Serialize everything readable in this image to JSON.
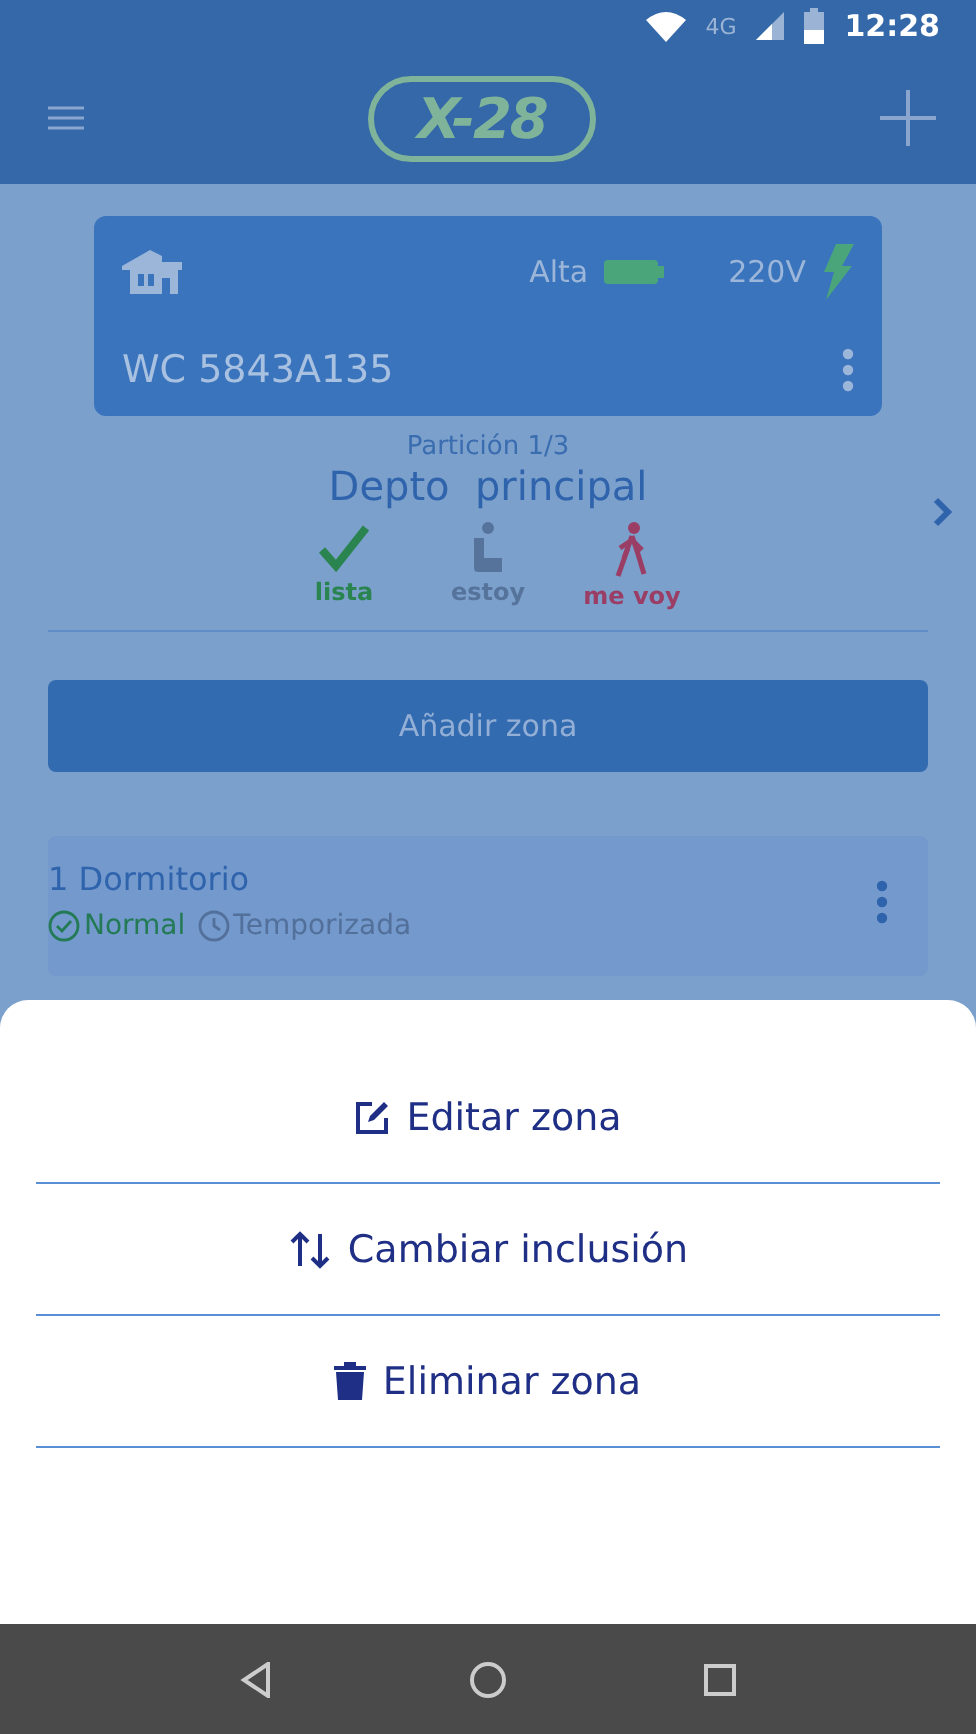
{
  "status_bar": {
    "network": "4G",
    "time": "12:28"
  },
  "app_bar": {
    "logo": "X-28"
  },
  "panel": {
    "level_label": "Alta",
    "voltage": "220V",
    "serial": "WC 5843A135"
  },
  "partition": {
    "label": "Partición 1/3",
    "name": "Depto  principal"
  },
  "modes": [
    {
      "kind": "check",
      "label": "lista",
      "color": "#2a8450"
    },
    {
      "kind": "seat",
      "label": "estoy",
      "color": "#56739b"
    },
    {
      "kind": "walk",
      "label": "me voy",
      "color": "#9a3e66"
    }
  ],
  "add_button": "Añadir zona",
  "zones": [
    {
      "name": "1 Dormitorio",
      "statuses": [
        {
          "kind": "check",
          "label": "Normal",
          "selected": true
        },
        {
          "kind": "clock",
          "label": "Temporizada",
          "selected": false
        }
      ]
    }
  ],
  "sheet": {
    "items": [
      {
        "kind": "edit",
        "label": "Editar zona"
      },
      {
        "kind": "swap",
        "label": "Cambiar inclusión"
      },
      {
        "kind": "trash",
        "label": "Eliminar zona"
      }
    ]
  }
}
